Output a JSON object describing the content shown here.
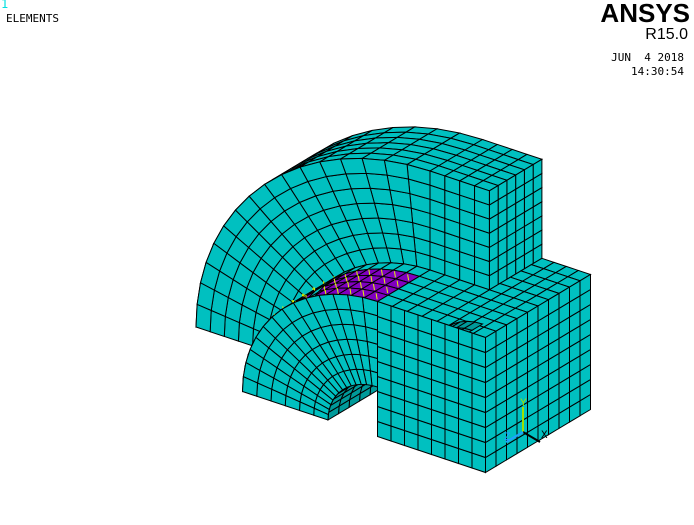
{
  "window_number": "1",
  "plot_label": "ELEMENTS",
  "brand": "ANSYS",
  "version": "R15.0",
  "date": "JUN  4 2018",
  "time": "14:30:54",
  "triad": {
    "x_label": "X",
    "y_label": "Y",
    "z_label": "Z"
  },
  "colors": {
    "element_fill": "#00c0c0",
    "contact_fill": "#8000c0",
    "mesh_line": "#000000",
    "hole_fill": "#009a9a",
    "contact_marker": "#e0ff00",
    "triad_x": "#000000",
    "triad_y": "#a0e000",
    "triad_z": "#20a0ff"
  }
}
